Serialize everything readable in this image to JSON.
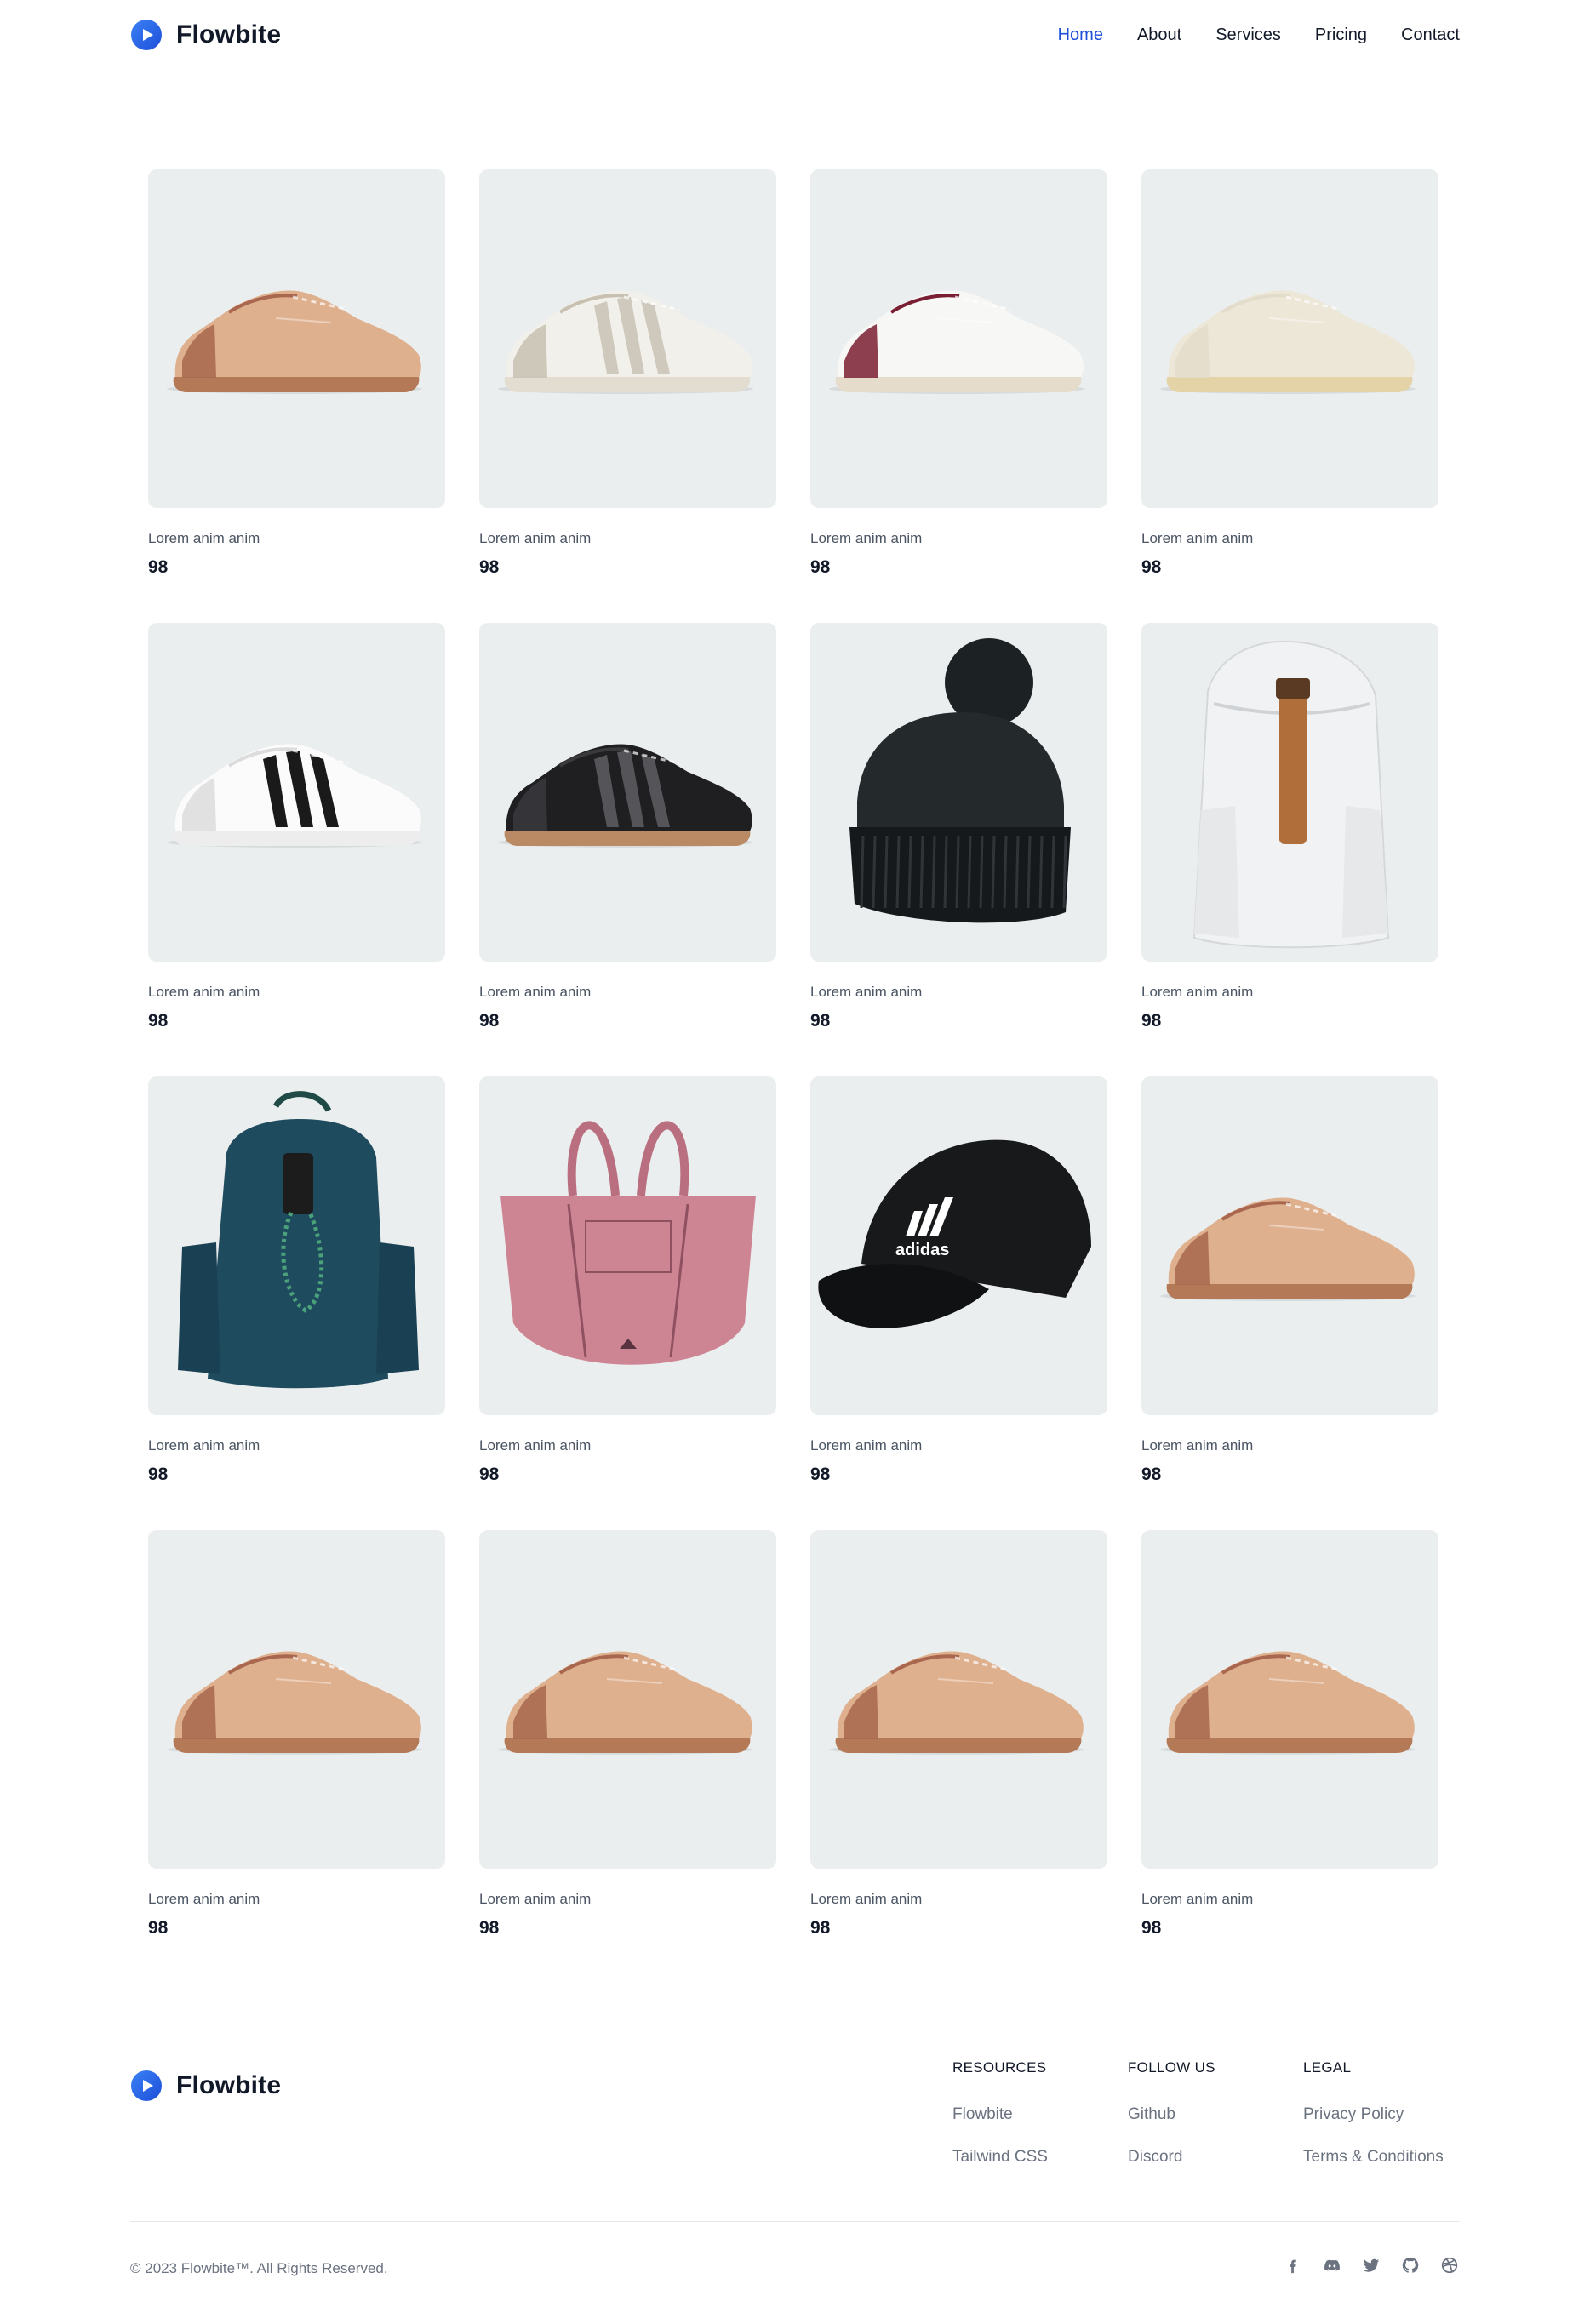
{
  "brand": {
    "name": "Flowbite"
  },
  "nav": [
    {
      "label": "Home",
      "active": true
    },
    {
      "label": "About"
    },
    {
      "label": "Services"
    },
    {
      "label": "Pricing"
    },
    {
      "label": "Contact"
    }
  ],
  "products": [
    {
      "title": "Lorem anim anim",
      "price": "98",
      "image": "tan-sneaker"
    },
    {
      "title": "Lorem anim anim",
      "price": "98",
      "image": "white-speckled-sneaker"
    },
    {
      "title": "Lorem anim anim",
      "price": "98",
      "image": "white-burgundy-sneaker"
    },
    {
      "title": "Lorem anim anim",
      "price": "98",
      "image": "cream-sneaker"
    },
    {
      "title": "Lorem anim anim",
      "price": "98",
      "image": "white-black-stripe-sneaker"
    },
    {
      "title": "Lorem anim anim",
      "price": "98",
      "image": "black-sneaker"
    },
    {
      "title": "Lorem anim anim",
      "price": "98",
      "image": "black-beanie"
    },
    {
      "title": "Lorem anim anim",
      "price": "98",
      "image": "white-backpack"
    },
    {
      "title": "Lorem anim anim",
      "price": "98",
      "image": "teal-backpack"
    },
    {
      "title": "Lorem anim anim",
      "price": "98",
      "image": "pink-tote-bag"
    },
    {
      "title": "Lorem anim anim",
      "price": "98",
      "image": "black-cap"
    },
    {
      "title": "Lorem anim anim",
      "price": "98",
      "image": "tan-sneaker"
    },
    {
      "title": "Lorem anim anim",
      "price": "98",
      "image": "tan-sneaker"
    },
    {
      "title": "Lorem anim anim",
      "price": "98",
      "image": "tan-sneaker"
    },
    {
      "title": "Lorem anim anim",
      "price": "98",
      "image": "tan-sneaker"
    },
    {
      "title": "Lorem anim anim",
      "price": "98",
      "image": "tan-sneaker"
    }
  ],
  "footer": {
    "brand": "Flowbite",
    "columns": [
      {
        "heading": "Resources",
        "links": [
          "Flowbite",
          "Tailwind CSS"
        ]
      },
      {
        "heading": "Follow us",
        "links": [
          "Github",
          "Discord"
        ]
      },
      {
        "heading": "Legal",
        "links": [
          "Privacy Policy",
          "Terms & Conditions"
        ]
      }
    ],
    "copyright": "© 2023 Flowbite™. All Rights Reserved.",
    "socials": [
      "facebook-icon",
      "discord-icon",
      "twitter-icon",
      "github-icon",
      "dribbble-icon"
    ]
  },
  "colors": {
    "accent": "#1d4ed8",
    "logo": "#2563eb",
    "card_bg": "#ebeeef"
  }
}
